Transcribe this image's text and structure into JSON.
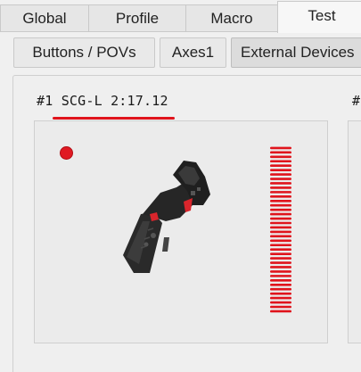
{
  "main_tabs": [
    {
      "label": "Global",
      "active": false
    },
    {
      "label": "Profile",
      "active": false
    },
    {
      "label": "Macro",
      "active": false
    },
    {
      "label": "Test",
      "active": true
    }
  ],
  "sub_tabs": [
    {
      "label": "Buttons / POVs",
      "active": false
    },
    {
      "label": "Axes1",
      "active": false
    },
    {
      "label": "External Devices",
      "active": true
    }
  ],
  "devices": [
    {
      "title": "#1 SCG-L 2:17.12"
    },
    {
      "title": "#"
    }
  ],
  "colors": {
    "accent_red": "#e0141c"
  },
  "icons": {
    "device_image": "joystick-grip-icon",
    "button_state": "pressed-indicator",
    "axis_meter": "axis-value-bar"
  }
}
